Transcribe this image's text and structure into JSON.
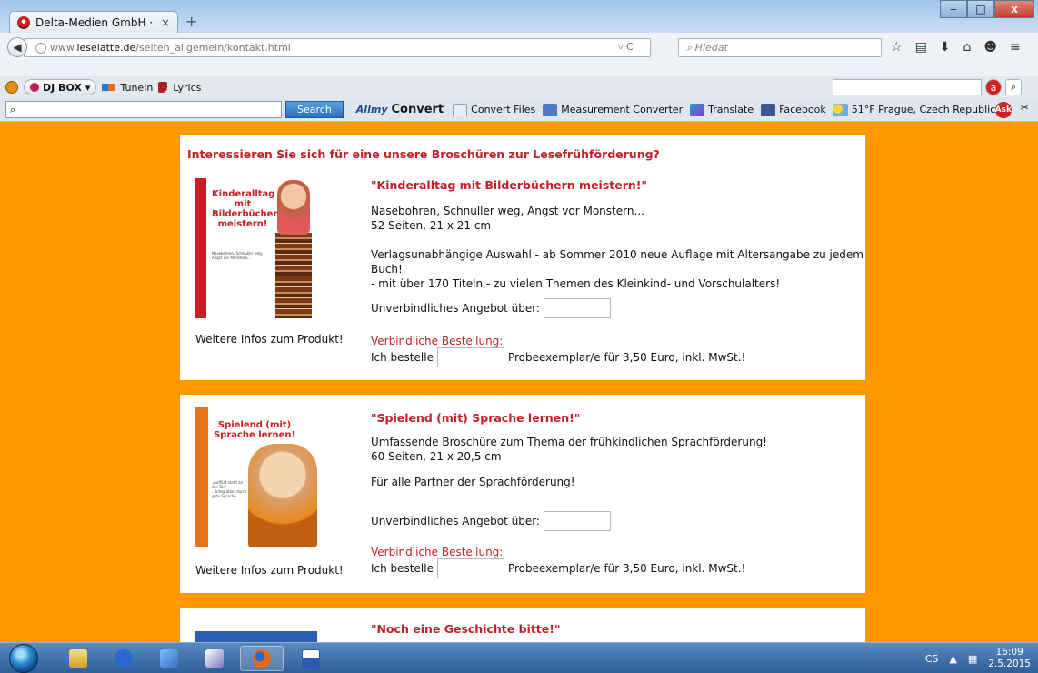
{
  "browser": {
    "tab_title": "Delta-Medien GmbH · Age...",
    "tab_close": "×",
    "new_tab": "+",
    "url_prefix": "www.",
    "url_domain": "leselatte.de",
    "url_path": "/seiten_allgemein/kontakt.html",
    "url_tools": "▿ C",
    "search_placeholder": "Hledat",
    "nav_icons": [
      "☆",
      "▤",
      "⬇",
      "⌂",
      "☻",
      "≡"
    ]
  },
  "djbox_toolbar": {
    "djbox_label": "DJ BOX",
    "tunein_label": "TuneIn",
    "lyrics_label": "Lyrics"
  },
  "ask_toolbar": {
    "search_icon": "⌕",
    "search_button": "Search",
    "allmy_label": "All",
    "allmy_label2": "my",
    "convert_label": "Convert",
    "convert_files": "Convert Files",
    "measurement_converter": "Measurement Converter",
    "translate": "Translate",
    "facebook": "Facebook",
    "weather": "51°F Prague, Czech Republic"
  },
  "page": {
    "intro_heading": "Interessieren Sie sich für eine unsere Broschüren zur Lesefrühförderung?",
    "products": [
      {
        "title": "\"Kinderalltag mit Bilderbüchern meistern!\"",
        "desc_line1": "Nasebohren, Schnuller weg, Angst vor Monstern...",
        "desc_line2": "52 Seiten, 21 x 21 cm",
        "desc_line3": "Verlagsunabhängige Auswahl - ab Sommer 2010 neue Auflage mit Altersangabe zu jedem Buch!",
        "desc_line4": "- mit über 170 Titeln - zu vielen Themen des Kleinkind- und Vorschulalters!",
        "offer_label": "Unverbindliches Angebot über:",
        "order_heading": "Verbindliche Bestellung:",
        "order_prefix": "Ich bestelle",
        "order_suffix": "Probeexemplar/e für 3,50 Euro, inkl. MwSt.!",
        "info_link": "Weitere Infos zum Produkt!",
        "cover_title": "Kinderalltag mit Bilderbüchern meistern!",
        "cover_subtitle": "Nasebohren, Schnuller weg, Angst vor Monstern..."
      },
      {
        "title": "\"Spielend (mit) Sprache lernen!\"",
        "desc_line1": "Umfassende Broschüre zum Thema der frühkindlichen Sprachförderung!",
        "desc_line2": "60 Seiten, 21 x 20,5 cm",
        "desc_line3": "Für alle Partner der Sprachförderung!",
        "offer_label": "Unverbindliches Angebot über:",
        "order_heading": "Verbindliche Bestellung:",
        "order_prefix": "Ich bestelle",
        "order_suffix": "Probeexemplar/e für 3,50 Euro, inkl. MwSt.!",
        "info_link": "Weitere Infos zum Produkt!",
        "cover_title": "Spielend (mit) Sprache lernen!",
        "cover_subtitle": "„Auffällt steht an der Tür\" ...Integration durch gute Sprache"
      },
      {
        "title": "\"Noch eine Geschichte bitte!\""
      }
    ]
  },
  "taskbar": {
    "lang": "CS",
    "tray_arrow": "▲",
    "time": "16:09",
    "date": "2.5.2015"
  },
  "colors": {
    "page_bg": "#ff9900",
    "accent_red": "#c41e2a"
  }
}
